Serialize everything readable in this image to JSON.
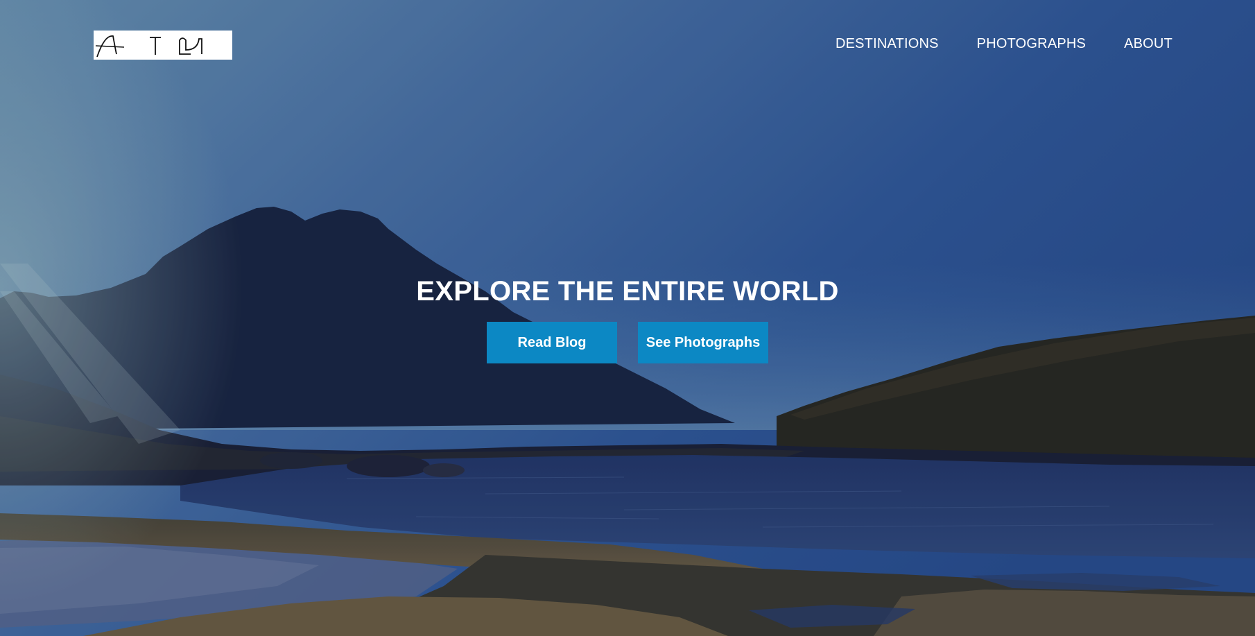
{
  "brand": {
    "logo_text": "AcrossTheGlobe"
  },
  "nav": {
    "items": [
      {
        "label": "DESTINATIONS"
      },
      {
        "label": "PHOTOGRAPHS"
      },
      {
        "label": "ABOUT"
      }
    ]
  },
  "hero": {
    "title": "EXPLORE THE ENTIRE WORLD",
    "primary_button": "Read Blog",
    "secondary_button": "See Photographs"
  },
  "colors": {
    "button_bg": "#0c88c4",
    "sky_top": "#2f5a98",
    "text": "#ffffff"
  }
}
